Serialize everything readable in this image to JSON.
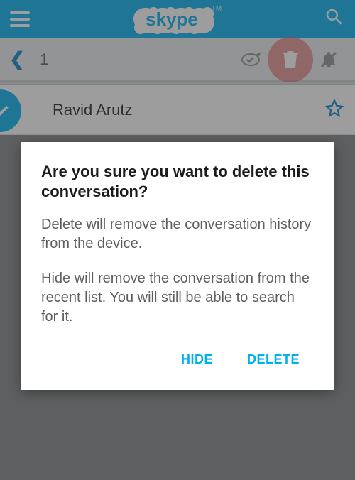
{
  "topbar": {
    "logo_text": "skype",
    "logo_tm": "TM"
  },
  "subbar": {
    "selected_count": "1"
  },
  "contact": {
    "name": "Ravid Arutz"
  },
  "dialog": {
    "title": "Are you sure you want to delete this conversation?",
    "body_delete": "Delete will remove the conversation history from the device.",
    "body_hide": "Hide will remove the conversation from the recent list. You will still be able to search for it.",
    "hide_label": "HIDE",
    "delete_label": "DELETE"
  }
}
